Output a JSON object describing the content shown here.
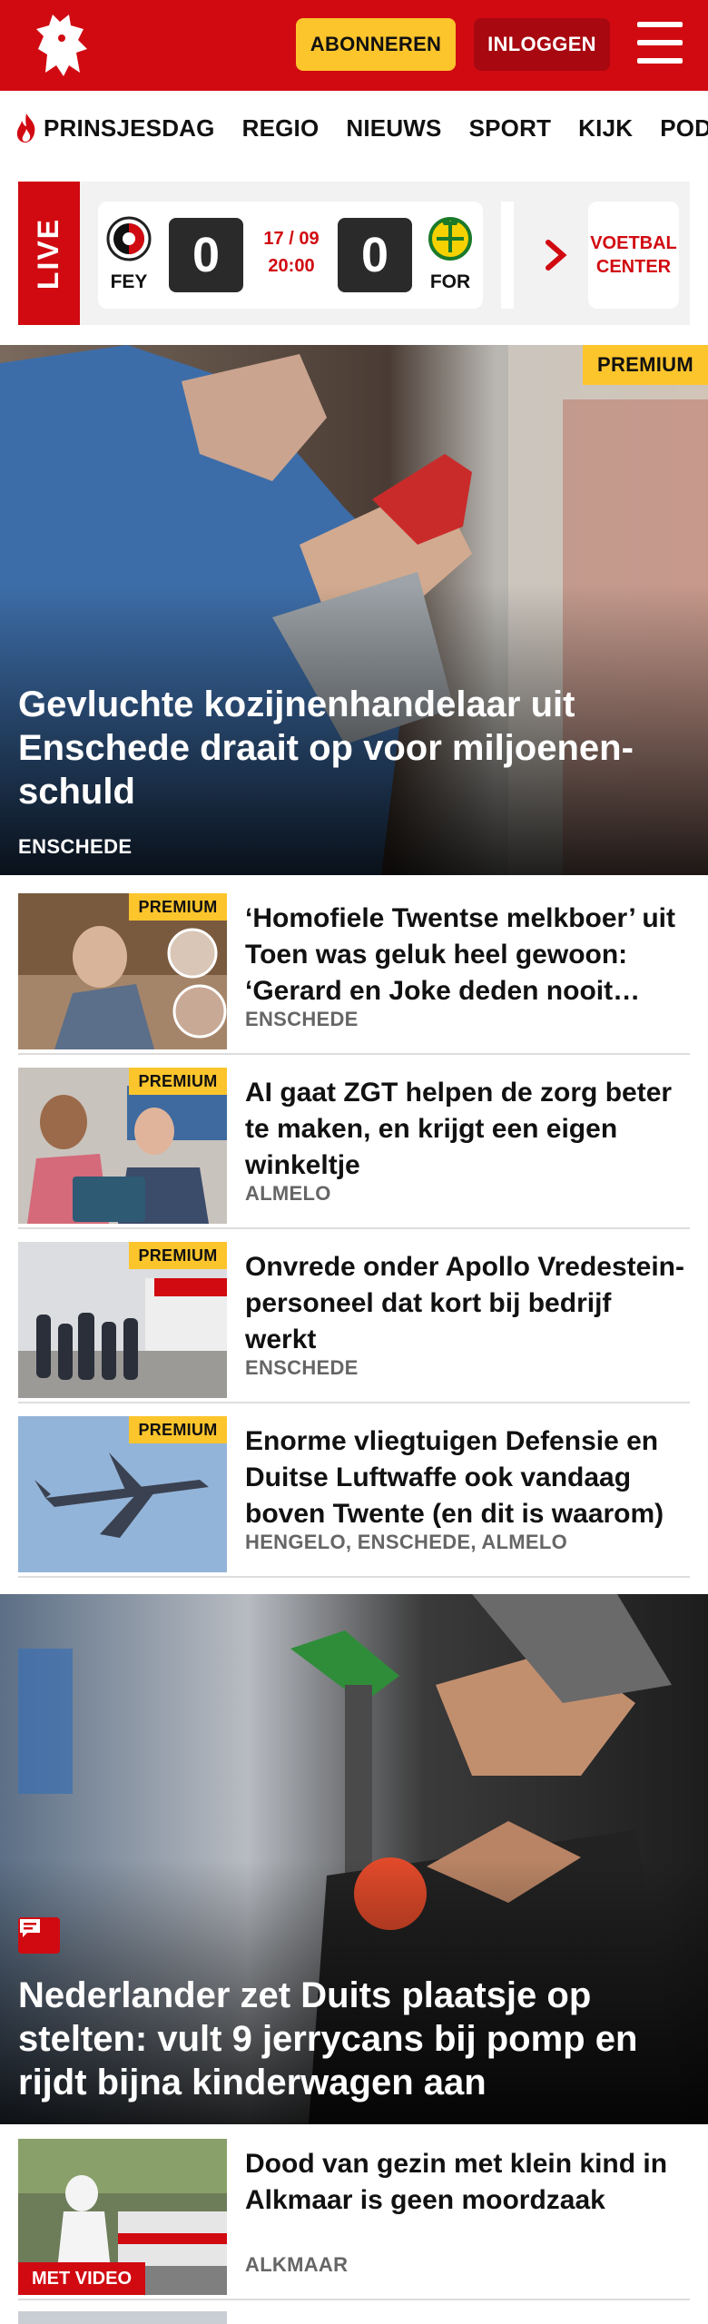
{
  "header": {
    "subscribe_label": "ABONNEREN",
    "login_label": "INLOGGEN",
    "brand_color": "#d10a11",
    "subscribe_color": "#fdc52c"
  },
  "nav": {
    "items": [
      {
        "label": "PRINSJESDAG",
        "icon": "flame-icon"
      },
      {
        "label": "REGIO"
      },
      {
        "label": "NIEUWS"
      },
      {
        "label": "SPORT"
      },
      {
        "label": "KIJK"
      },
      {
        "label": "PODCA"
      }
    ]
  },
  "live": {
    "tag": "LIVE",
    "home_team": "FEY",
    "away_team": "FOR",
    "home_score": "0",
    "away_score": "0",
    "date": "17 / 09",
    "time": "20:00",
    "voetbal_center": "VOETBAL CENTER"
  },
  "hero": {
    "badge": "PREMIUM",
    "title": "Gevluchte kozijnenhandelaar uit Enschede draait op voor miljoenen­schuld",
    "location": "ENSCHEDE"
  },
  "articles": [
    {
      "badge": "PREMIUM",
      "title": "‘Homofiele Twentse melkboer’ uit Toen was geluk heel gewoon: ‘Gerard en Joke deden nooit…",
      "location": "ENSCHEDE"
    },
    {
      "badge": "PREMIUM",
      "title": "AI gaat ZGT helpen de zorg beter te maken, en krijgt een eigen winkeltje",
      "location": "ALMELO"
    },
    {
      "badge": "PREMIUM",
      "title": "Onvrede onder Apollo Vredestein-personeel dat kort bij bedrijf werkt",
      "location": "ENSCHEDE"
    },
    {
      "badge": "PREMIUM",
      "title": "Enorme vliegtuigen Defensie en Duitse Luftwaffe ook vandaag boven Twente (en dit is waarom)",
      "location": "HENGELO, ENSCHEDE, ALMELO"
    }
  ],
  "hero2": {
    "title": "Nederlander zet Duits plaatsje op stelten: vult 9 jerrycans bij pomp en rijdt bijna kinderwagen aan",
    "icon": "comment-icon"
  },
  "bottom_article": {
    "badge": "MET VIDEO",
    "title": "Dood van gezin met klein kind in Alkmaar is geen moordzaak",
    "location": "ALKMAAR"
  }
}
